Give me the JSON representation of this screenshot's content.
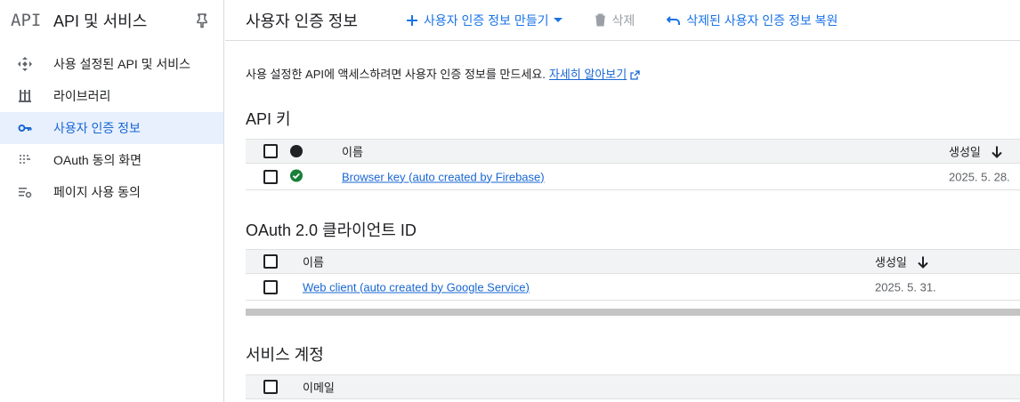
{
  "sidebar": {
    "logo": "API",
    "title": "API 및 서비스",
    "items": [
      {
        "label": "사용 설정된 API 및 서비스",
        "icon": "diamond-arrows-icon"
      },
      {
        "label": "라이브러리",
        "icon": "library-icon"
      },
      {
        "label": "사용자 인증 정보",
        "icon": "key-icon"
      },
      {
        "label": "OAuth 동의 화면",
        "icon": "dots-grid-icon"
      },
      {
        "label": "페이지 사용 동의",
        "icon": "settings-list-icon"
      }
    ]
  },
  "topbar": {
    "title": "사용자 인증 정보",
    "create_label": "사용자 인증 정보 만들기",
    "delete_label": "삭제",
    "restore_label": "삭제된 사용자 인증 정보 복원"
  },
  "intro": {
    "text": "사용 설정한 API에 액세스하려면 사용자 인증 정보를 만드세요.",
    "link": "자세히 알아보기"
  },
  "api_keys": {
    "title": "API 키",
    "header": {
      "name": "이름",
      "created": "생성일"
    },
    "rows": [
      {
        "name": "Browser key (auto created by Firebase)",
        "created": "2025. 5. 28."
      }
    ]
  },
  "oauth": {
    "title": "OAuth 2.0 클라이언트 ID",
    "header": {
      "name": "이름",
      "created": "생성일"
    },
    "rows": [
      {
        "name": "Web client (auto created by Google Service)",
        "created": "2025. 5. 31."
      }
    ]
  },
  "service_accounts": {
    "title": "서비스 계정",
    "header": {
      "email": "이메일"
    }
  },
  "colors": {
    "accent": "#1a73e8",
    "active_bg": "#e8f0fe",
    "status_ok": "#188038"
  }
}
